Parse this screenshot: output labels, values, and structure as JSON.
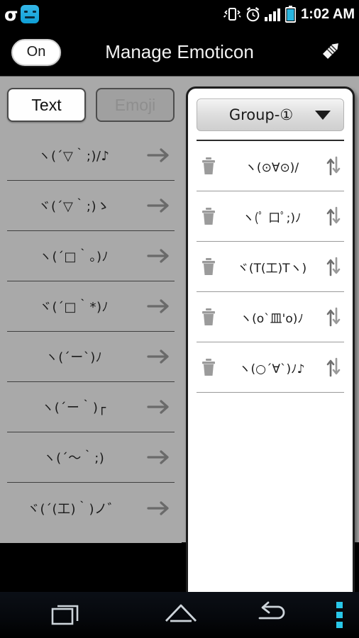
{
  "status_bar": {
    "left_icons": [
      "sigma-icon",
      "emoticon-app-icon"
    ],
    "right_icons": [
      "vibrate-icon",
      "alarm-icon",
      "signal-icon",
      "battery-icon"
    ],
    "time": "1:02 AM"
  },
  "title_bar": {
    "toggle_label": "On",
    "title": "Manage Emoticon",
    "edit_icon": "pencil-icon"
  },
  "tabs": [
    {
      "label": "Text",
      "active": true
    },
    {
      "label": "Emoji",
      "active": false
    }
  ],
  "emoticon_list": [
    {
      "text": "ヽ(´▽｀;)/♪"
    },
    {
      "text": "ヾ(´▽｀;)ゝ"
    },
    {
      "text": "ヽ(´□｀｡)ﾉ"
    },
    {
      "text": "ヾ(´□｀*)ﾉ"
    },
    {
      "text": "ヽ(´ー`)ﾉ"
    },
    {
      "text": "ヽ(´ー｀)┌"
    },
    {
      "text": "ヽ(´～｀;)"
    },
    {
      "text": "ヾ(´(工)｀)ノ゛"
    }
  ],
  "group_panel": {
    "selected_group": "Group-①",
    "caret_icon": "chevron-down-icon",
    "rows": [
      {
        "text": "ヽ(⊙∀⊙)/",
        "delete_icon": "trash-icon",
        "reorder_icon": "reorder-icon"
      },
      {
        "text": "ヽ(ﾟ 口ﾟ;)ﾉ",
        "delete_icon": "trash-icon",
        "reorder_icon": "reorder-icon"
      },
      {
        "text": "ヾ(T(工)Tヽ)",
        "delete_icon": "trash-icon",
        "reorder_icon": "reorder-icon"
      },
      {
        "text": "ヽ(o`皿'o)ﾉ",
        "delete_icon": "trash-icon",
        "reorder_icon": "reorder-icon"
      },
      {
        "text": "ヽ(○´∀`)ﾉ♪",
        "delete_icon": "trash-icon",
        "reorder_icon": "reorder-icon"
      }
    ]
  },
  "nav_bar": {
    "buttons": [
      "recents-icon",
      "home-icon",
      "back-icon",
      "menu-icon"
    ]
  },
  "colors": {
    "accent": "#29c7e8",
    "app_icon": "#0f9fd6",
    "content_bg": "#a9a9a9",
    "bar_bg": "#000000"
  }
}
